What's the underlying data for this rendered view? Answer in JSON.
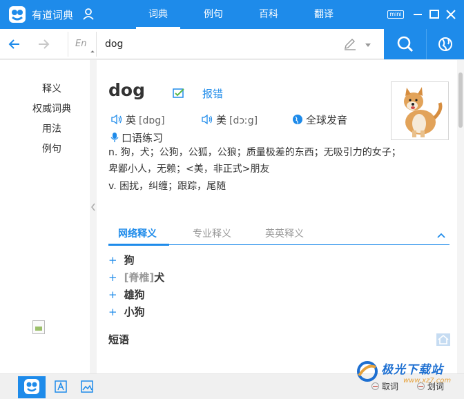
{
  "app": {
    "title": "有道词典"
  },
  "top_tabs": [
    {
      "label": "词典",
      "active": true
    },
    {
      "label": "例句",
      "active": false
    },
    {
      "label": "百科",
      "active": false
    },
    {
      "label": "翻译",
      "active": false
    }
  ],
  "window_buttons": {
    "mini_label": "mini"
  },
  "search": {
    "lang": "En",
    "query": "dog"
  },
  "left_nav": [
    "释义",
    "权威词典",
    "用法",
    "例句"
  ],
  "entry": {
    "word": "dog",
    "report_label": "报错",
    "uk": {
      "label": "英",
      "phonetic": "[dɒg]"
    },
    "us": {
      "label": "美",
      "phonetic": "[dɔːg]"
    },
    "global_label": "全球发音",
    "oral_label": "口语练习",
    "definitions": [
      "n. 狗，犬；公狗，公狐，公狼；质量极差的东西；无吸引力的女子；",
      "卑鄙小人，无赖；<美，非正式>朋友",
      "v. 困扰，纠缠；跟踪，尾随"
    ]
  },
  "sub_tabs": [
    {
      "label": "网络释义",
      "active": true
    },
    {
      "label": "专业释义",
      "active": false
    },
    {
      "label": "英英释义",
      "active": false
    }
  ],
  "web_meanings": [
    {
      "tag": "",
      "text": "狗"
    },
    {
      "tag": "[脊椎]",
      "text": "犬"
    },
    {
      "tag": "",
      "text": "雄狗"
    },
    {
      "tag": "",
      "text": "小狗"
    }
  ],
  "phrases_heading": "短语",
  "footer": {
    "toggle_1": "取词",
    "toggle_2": "划词"
  },
  "watermark": {
    "text": "极光下载站",
    "url": "www.xz7.com"
  },
  "colors": {
    "accent": "#1e8bea",
    "background": "#ffffff",
    "chrome": "#f0f0f0"
  }
}
